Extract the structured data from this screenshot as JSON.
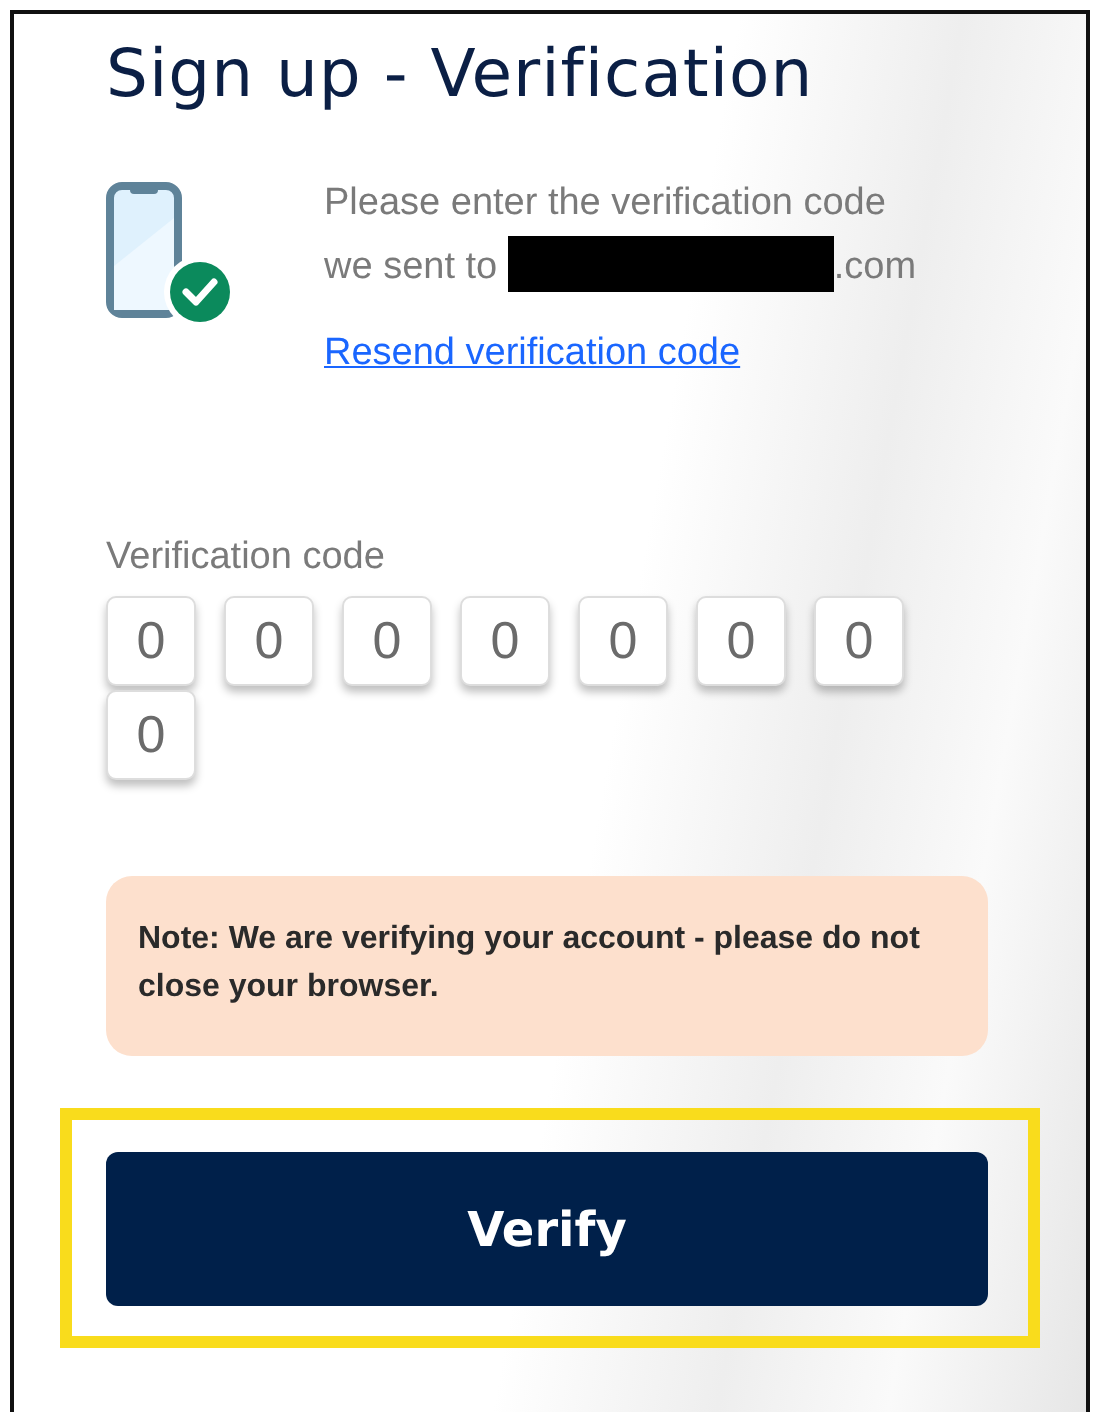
{
  "title": "Sign up - Verification",
  "message": {
    "line_1": "Please enter the verification code",
    "prefix": "we sent to",
    "email": {
      "visible": ".com",
      "redacted": true
    }
  },
  "resend_link": "Resend verification code",
  "code_field": {
    "label": "Verification code",
    "digits": [
      "0",
      "0",
      "0",
      "0",
      "0",
      "0",
      "0",
      "0"
    ]
  },
  "note": "Note: We are verifying your account - please do not close your browser.",
  "verify_button": {
    "label": "Verify",
    "highlighted": true
  }
}
